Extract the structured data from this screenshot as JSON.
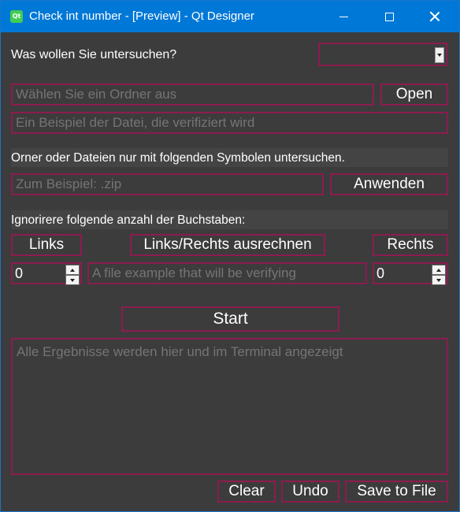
{
  "window": {
    "title": "Check int number - [Preview] - Qt Designer",
    "app_icon_text": "Qt",
    "buttons": [
      "minimize",
      "maximize",
      "close"
    ]
  },
  "labels": {
    "what_to_check": "Was wollen Sie untersuchen?",
    "symbols_filter": "Orner oder Dateien nur mit folgenden Symbolen untersuchen.",
    "ignore_chars": "Ignorirere folgende anzahl der Buchstaben:"
  },
  "combo": {
    "value": ""
  },
  "folder_input": {
    "placeholder": "Wählen Sie ein Ordner aus",
    "value": ""
  },
  "open_button": "Open",
  "example_file_input": {
    "placeholder": "Ein Beispiel der Datei, die verifiziert wird",
    "value": ""
  },
  "symbols_input": {
    "placeholder": "Zum Beispiel: .zip",
    "value": ""
  },
  "apply_button": "Anwenden",
  "links_button": "Links",
  "compute_button": "Links/Rechts ausrechnen",
  "rechts_button": "Rechts",
  "left_spin": {
    "value": "0"
  },
  "right_spin": {
    "value": "0"
  },
  "preview_input": {
    "placeholder": "A file example that will be verifying",
    "value": ""
  },
  "start_button": "Start",
  "results": {
    "placeholder": "Alle Ergebnisse werden hier und im Terminal angezeigt"
  },
  "bottom_buttons": {
    "clear": "Clear",
    "undo": "Undo",
    "save": "Save to File"
  },
  "colors": {
    "titlebar": "#0078d7",
    "accent_border": "#8c1c4f",
    "background": "#3c3c3c",
    "text": "#ffffff",
    "placeholder": "#9a9a9a"
  }
}
